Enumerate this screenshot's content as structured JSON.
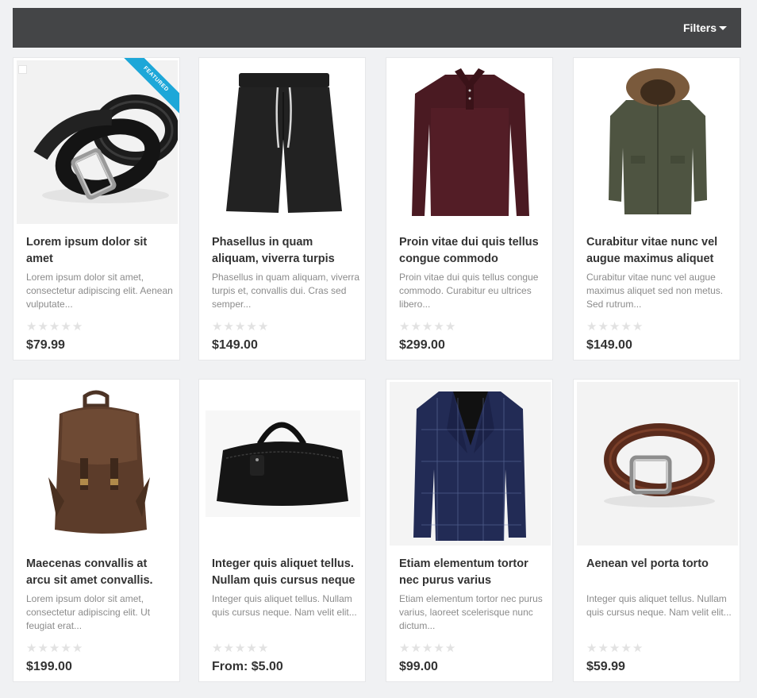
{
  "toolbar": {
    "filters_label": "Filters"
  },
  "products": [
    {
      "title": "Lorem ipsum dolor sit amet",
      "description": "Lorem ipsum dolor sit amet, consectetur adipiscing elit. Aenean vulputate...",
      "price": "$79.99",
      "rating": 0,
      "featured": true,
      "featured_label": "FEATURED",
      "image": "belt-black-icon"
    },
    {
      "title": "Phasellus in quam aliquam, viverra turpis",
      "description": "Phasellus in quam aliquam, viverra turpis et, convallis dui. Cras sed semper...",
      "price": "$149.00",
      "rating": 0,
      "image": "shorts-icon"
    },
    {
      "title": "Proin vitae dui quis tellus congue commodo",
      "description": "Proin vitae dui quis tellus congue commodo. Curabitur eu ultrices libero...",
      "price": "$299.00",
      "rating": 0,
      "image": "polo-shirt-icon"
    },
    {
      "title": "Curabitur vitae nunc vel augue maximus aliquet",
      "description": "Curabitur vitae nunc vel augue maximus aliquet sed non metus. Sed rutrum...",
      "price": "$149.00",
      "rating": 0,
      "image": "parka-icon"
    },
    {
      "title": "Maecenas convallis at arcu sit amet convallis.",
      "description": "Lorem ipsum dolor sit amet, consectetur adipiscing elit. Ut feugiat erat...",
      "price": "$199.00",
      "rating": 0,
      "image": "backpack-icon"
    },
    {
      "title": "Integer quis aliquet tellus. Nullam quis cursus neque",
      "description": "Integer quis aliquet tellus. Nullam quis cursus neque. Nam velit elit...",
      "price": "From: $5.00",
      "rating": 0,
      "image": "duffel-bag-icon"
    },
    {
      "title": "Etiam elementum tortor nec purus varius",
      "description": "Etiam elementum tortor nec purus varius, laoreet scelerisque nunc dictum...",
      "price": "$99.00",
      "rating": 0,
      "image": "blazer-icon"
    },
    {
      "title": "Aenean vel porta torto",
      "description": "Integer quis aliquet tellus. Nullam quis cursus neque. Nam velit elit...",
      "price": "$59.99",
      "rating": 0,
      "image": "belt-brown-icon"
    }
  ],
  "colors": {
    "topbar": "#444547",
    "page_bg": "#f0f1f3",
    "ribbon": "#1da7d8",
    "star_empty": "#e2e2e2"
  }
}
